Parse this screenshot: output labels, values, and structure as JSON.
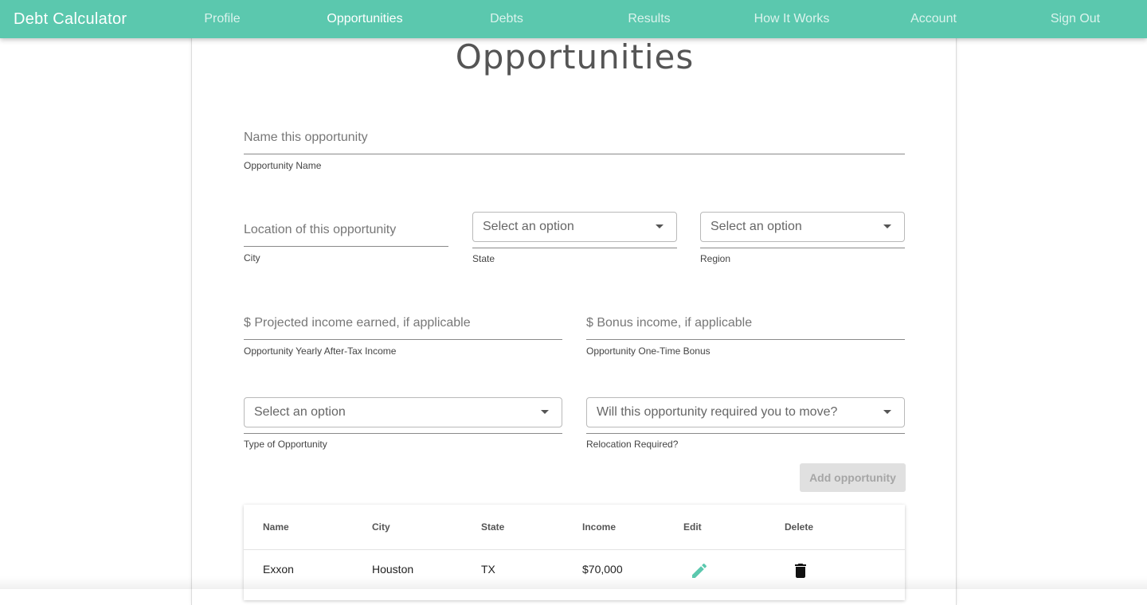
{
  "nav": {
    "brand": "Debt Calculator",
    "links": [
      "Profile",
      "Opportunities",
      "Debts",
      "Results",
      "How It Works",
      "Account",
      "Sign Out"
    ],
    "active": "Opportunities",
    "color": "#5bc8ae"
  },
  "page": {
    "title": "Opportunities"
  },
  "form": {
    "opportunity_name": {
      "placeholder": "Name this opportunity",
      "value": "",
      "helper": "Opportunity Name"
    },
    "city": {
      "placeholder": "Location of this opportunity",
      "value": "",
      "helper": "City"
    },
    "state": {
      "selected": "Select an option",
      "helper": "State"
    },
    "region": {
      "selected": "Select an option",
      "helper": "Region"
    },
    "income": {
      "placeholder": "$ Projected income earned, if applicable",
      "value": "",
      "helper": "Opportunity Yearly After-Tax Income"
    },
    "bonus": {
      "placeholder": "$ Bonus income, if applicable",
      "value": "",
      "helper": "Opportunity One-Time Bonus"
    },
    "type": {
      "selected": "Select an option",
      "helper": "Type of Opportunity"
    },
    "relocation": {
      "selected": "Will this opportunity required you to move?",
      "helper": "Relocation Required?"
    },
    "submit_label": "Add opportunity"
  },
  "table": {
    "headers": [
      "Name",
      "City",
      "State",
      "Income",
      "Edit",
      "Delete"
    ],
    "rows": [
      {
        "name": "Exxon",
        "city": "Houston",
        "state": "TX",
        "income": "$70,000",
        "edit_icon": "pencil-icon",
        "delete_icon": "trash-icon"
      }
    ],
    "edit_icon_color": "#5bc8ae"
  }
}
